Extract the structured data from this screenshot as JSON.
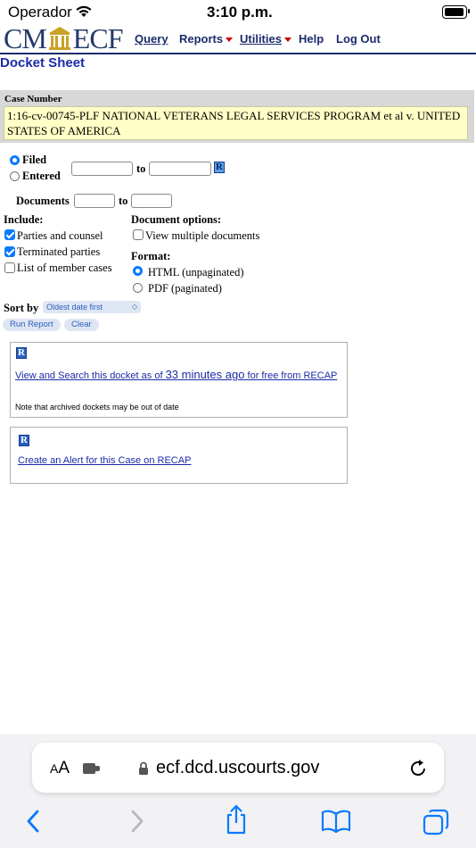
{
  "status_bar": {
    "carrier": "Operador",
    "time": "3:10 p.m."
  },
  "header": {
    "logo_text_left": "CM",
    "logo_text_right": "ECF",
    "nav": [
      "Query",
      "Reports",
      "Utilities",
      "Help",
      "Log Out"
    ],
    "page_title": "Docket Sheet"
  },
  "case": {
    "label": "Case Number",
    "value": "1:16-cv-00745-PLF NATIONAL VETERANS LEGAL SERVICES PROGRAM et al v. UNITED STATES OF AMERICA"
  },
  "form": {
    "filed_label": "Filed",
    "entered_label": "Entered",
    "to_label": "to",
    "filed_from": "",
    "filed_to": "",
    "documents_label": "Documents",
    "documents_from": "",
    "documents_to": "",
    "include_label": "Include:",
    "include_parties": "Parties and counsel",
    "include_terminated": "Terminated parties",
    "include_members": "List of member cases",
    "doc_options_label": "Document options:",
    "view_multiple": "View multiple documents",
    "format_label": "Format:",
    "format_html": "HTML (unpaginated)",
    "format_pdf": "PDF (paginated)",
    "sort_label": "Sort by",
    "sort_value": "Oldest date first",
    "run_report": "Run Report",
    "clear": "Clear",
    "recap_badge": "R"
  },
  "recap": {
    "view_prefix": "View and Search this docket as of ",
    "view_age": "33 minutes ago",
    "view_suffix": " for free from RECAP",
    "note": "Note that archived dockets may be out of date",
    "alert_link": "Create an Alert for this Case on RECAP"
  },
  "browser": {
    "text_size": "AA",
    "url": "ecf.dcd.uscourts.gov"
  },
  "colors": {
    "accent": "#0a7aff",
    "ecf_blue": "#1a2c6b",
    "case_yellow": "#ffffc6",
    "recap_blue": "#2a5fbf"
  }
}
